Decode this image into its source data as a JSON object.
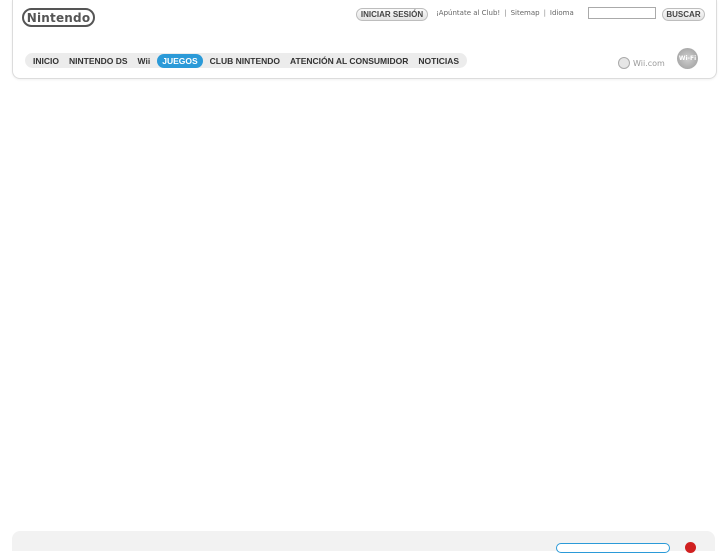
{
  "header": {
    "logo_text": "Nintendo",
    "login_label": "INICIAR SESIÓN",
    "links": [
      "¡Apúntate al Club!",
      "Sitemap",
      "Idioma"
    ],
    "search_value": "",
    "search_button_label": "BUSCAR"
  },
  "nav": {
    "tabs": [
      "INICIO",
      "NINTENDO DS",
      "Wii",
      "JUEGOS",
      "CLUB NINTENDO",
      "ATENCIÓN AL CONSUMIDOR",
      "NOTICIAS"
    ],
    "active_tab": "JUEGOS"
  },
  "brand": {
    "wii_com_label": "Wii.com",
    "wifi_badge_text": "Wi-Fi"
  },
  "colors": {
    "accent": "#2b9ad8",
    "footer_dot": "#d02020"
  },
  "icons": {
    "wii_com": "globe-icon",
    "wifi": "wifi-badge-icon"
  }
}
